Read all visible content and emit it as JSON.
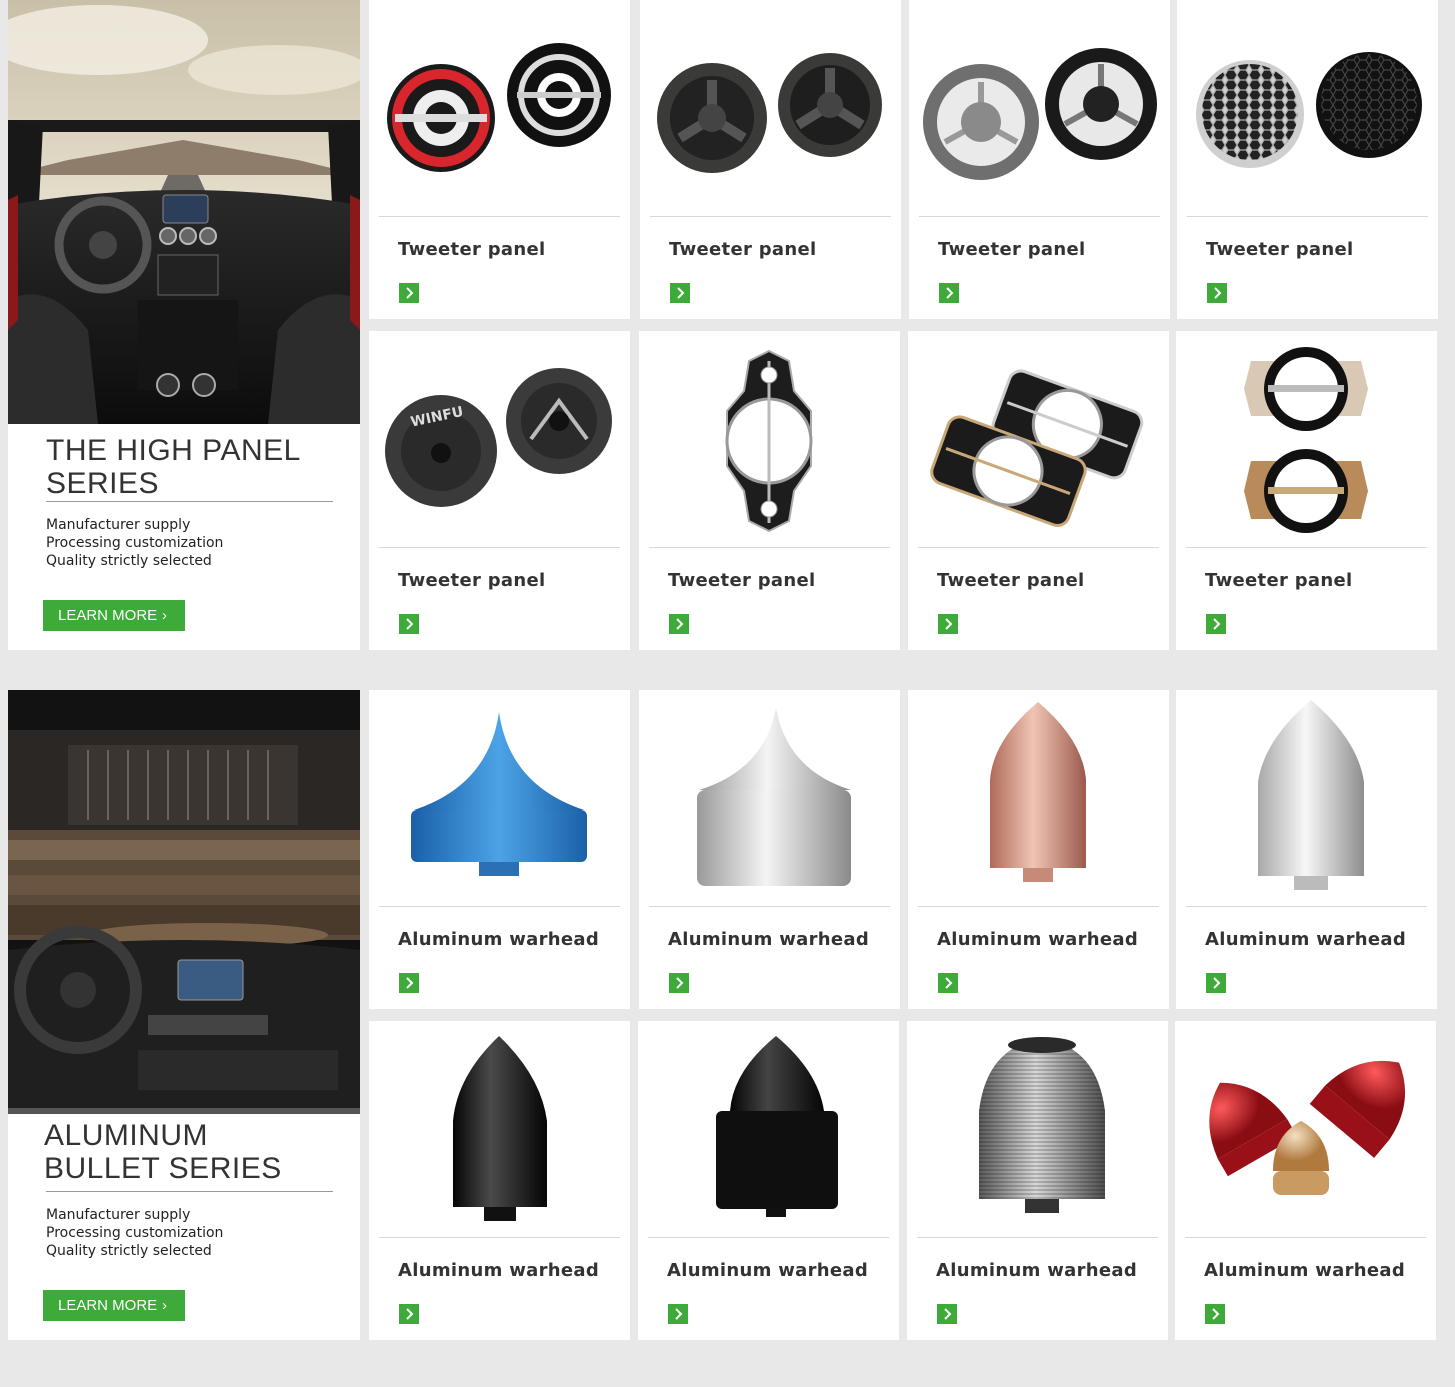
{
  "sections": [
    {
      "title_line1": "THE HIGH PANEL",
      "title_line2": "SERIES",
      "features": [
        "Manufacturer supply",
        "Processing customization",
        "Quality strictly selected"
      ],
      "cta": "LEARN MORE",
      "products": [
        {
          "name": "Tweeter panel",
          "icon": "red-ring-tweeter-panel"
        },
        {
          "name": "Tweeter panel",
          "icon": "three-spoke-tweeter-panel"
        },
        {
          "name": "Tweeter panel",
          "icon": "silver-spoke-tweeter-panel"
        },
        {
          "name": "Tweeter panel",
          "icon": "honeycomb-tweeter-panel"
        },
        {
          "name": "Tweeter panel",
          "icon": "winfu-tweeter-panel"
        },
        {
          "name": "Tweeter panel",
          "icon": "tall-frame-tweeter-panel"
        },
        {
          "name": "Tweeter panel",
          "icon": "double-frame-tweeter-panel"
        },
        {
          "name": "Tweeter panel",
          "icon": "gold-frame-tweeter-panel"
        }
      ]
    },
    {
      "title_line1": "ALUMINUM",
      "title_line2": "BULLET SERIES",
      "features": [
        "Manufacturer supply",
        "Processing customization",
        "Quality strictly selected"
      ],
      "cta": "LEARN MORE",
      "products": [
        {
          "name": "Aluminum warhead",
          "icon": "blue-cone-warhead"
        },
        {
          "name": "Aluminum warhead",
          "icon": "silver-cone-warhead"
        },
        {
          "name": "Aluminum warhead",
          "icon": "copper-bullet-warhead"
        },
        {
          "name": "Aluminum warhead",
          "icon": "silver-bullet-warhead"
        },
        {
          "name": "Aluminum warhead",
          "icon": "black-bullet-warhead"
        },
        {
          "name": "Aluminum warhead",
          "icon": "black-cone-warhead"
        },
        {
          "name": "Aluminum warhead",
          "icon": "ribbed-silver-warhead"
        },
        {
          "name": "Aluminum warhead",
          "icon": "red-gold-warheads"
        }
      ]
    }
  ],
  "colors": {
    "accent": "#3daa39",
    "background": "#e8e8e8",
    "card": "#ffffff",
    "text": "#333333"
  }
}
